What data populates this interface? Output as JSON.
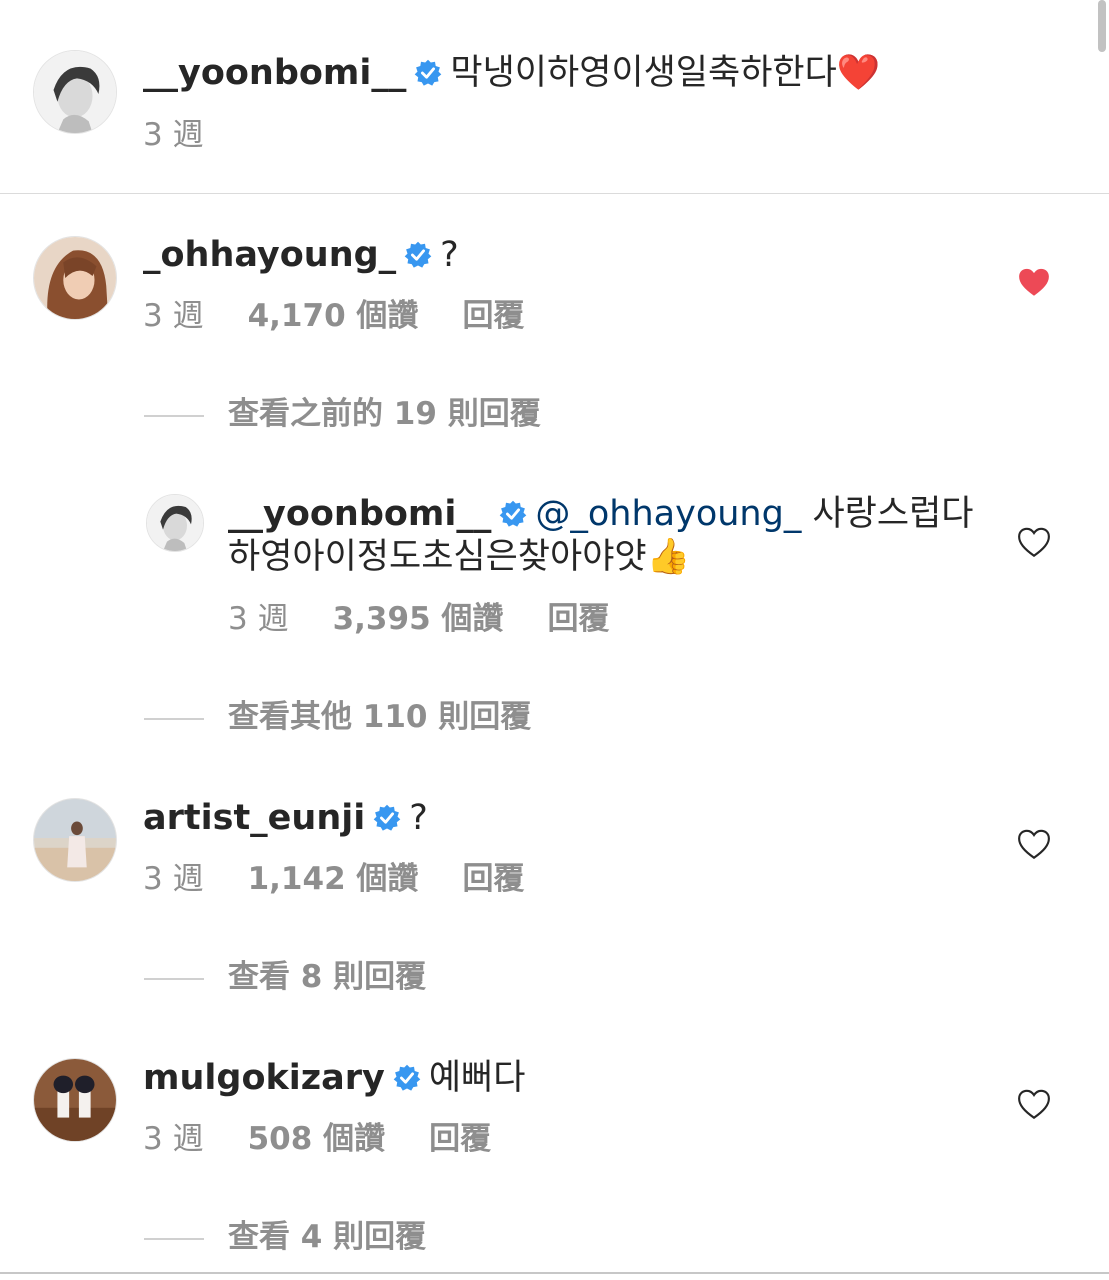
{
  "comments": [
    {
      "username": "__yoonbomi__",
      "text": "막냉이하영이생일축하한다",
      "emoji": "❤️",
      "time": "3 週"
    },
    {
      "username": "_ohhayoung_",
      "text": "?",
      "time": "3 週",
      "likes": "4,170 個讚",
      "reply_label": "回覆",
      "liked": true,
      "view_replies": "查看之前的 19 則回覆"
    },
    {
      "username": "__yoonbomi__",
      "mention": "@_ohhayoung_",
      "text_line1": "사랑스럽다",
      "text_line2": "하영아이정도초심은찾아야얏",
      "emoji": "👍",
      "time": "3 週",
      "likes": "3,395 個讚",
      "reply_label": "回覆",
      "liked": false,
      "view_replies": "查看其他 110 則回覆"
    },
    {
      "username": "artist_eunji",
      "text": "?",
      "time": "3 週",
      "likes": "1,142 個讚",
      "reply_label": "回覆",
      "liked": false,
      "view_replies": "查看 8 則回覆"
    },
    {
      "username": "mulgokizary",
      "text": "예뻐다",
      "time": "3 週",
      "likes": "508 個讚",
      "reply_label": "回覆",
      "liked": false,
      "view_replies": "查看 4 則回覆"
    }
  ],
  "colors": {
    "verified_blue": "#3897f0",
    "liked_red": "#ed4956",
    "meta_gray": "#8e8e8e",
    "mention_blue": "#00376b"
  },
  "icons": {
    "verified": "verified-badge-icon",
    "heart_outline": "heart-outline-icon",
    "heart_filled": "heart-filled-icon"
  }
}
